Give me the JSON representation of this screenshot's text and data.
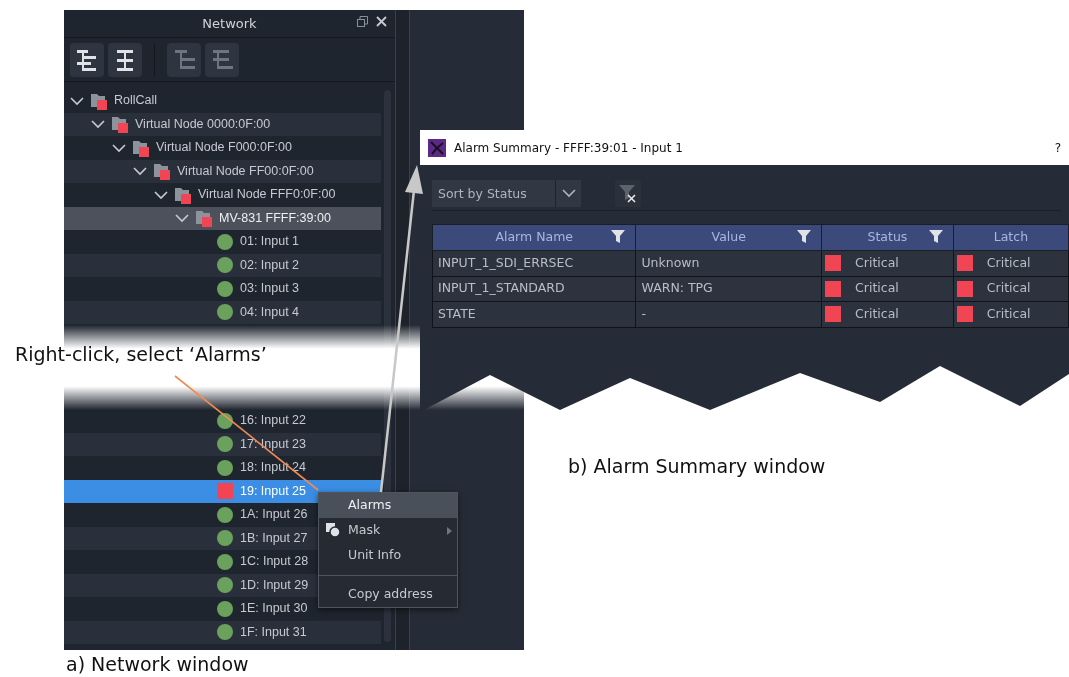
{
  "callout": {
    "text": "Right-click, select ‘Alarms’"
  },
  "network_window": {
    "title": "Network",
    "caption": "a) Network window",
    "toolbar": [
      {
        "kind": "expand",
        "disabled": false
      },
      {
        "kind": "collapse",
        "disabled": false
      },
      {
        "kind": "indent",
        "disabled": true
      },
      {
        "kind": "outdent",
        "disabled": true
      }
    ],
    "tree": [
      {
        "label": "RollCall",
        "kind": "folder",
        "color": "#f24553",
        "expanded": true,
        "selected": false,
        "highlighted": false,
        "children": [
          {
            "label": "Virtual Node 0000:0F:00",
            "kind": "folder",
            "color": "#f24553",
            "expanded": true,
            "selected": false,
            "highlighted": false,
            "children": [
              {
                "label": "Virtual Node F000:0F:00",
                "kind": "folder",
                "color": "#f24553",
                "expanded": true,
                "selected": false,
                "highlighted": false,
                "children": [
                  {
                    "label": "Virtual Node FF00:0F:00",
                    "kind": "folder",
                    "color": "#f24553",
                    "expanded": true,
                    "selected": false,
                    "highlighted": false,
                    "children": [
                      {
                        "label": "Virtual Node FFF0:0F:00",
                        "kind": "folder",
                        "color": "#f24553",
                        "expanded": true,
                        "selected": false,
                        "highlighted": false,
                        "children": [
                          {
                            "label": "MV-831 FFFF:39:00",
                            "kind": "folder",
                            "color": "#f24553",
                            "expanded": true,
                            "selected": false,
                            "highlighted": true,
                            "children": [
                              {
                                "label": "01: Input 1",
                                "kind": "input",
                                "color": "#6aa15c",
                                "selected": false,
                                "highlighted": false
                              },
                              {
                                "label": "02: Input 2",
                                "kind": "input",
                                "color": "#6aa15c",
                                "selected": false,
                                "highlighted": false
                              },
                              {
                                "label": "03: Input 3",
                                "kind": "input",
                                "color": "#6aa15c",
                                "selected": false,
                                "highlighted": false
                              },
                              {
                                "label": "04: Input 4",
                                "kind": "input",
                                "color": "#6aa15c",
                                "selected": false,
                                "highlighted": false
                              },
                              {
                                "label": "16: Input 22",
                                "kind": "input",
                                "color": "#6aa15c",
                                "selected": false,
                                "highlighted": false
                              },
                              {
                                "label": "17: Input 23",
                                "kind": "input",
                                "color": "#6aa15c",
                                "selected": false,
                                "highlighted": false
                              },
                              {
                                "label": "18: Input 24",
                                "kind": "input",
                                "color": "#6aa15c",
                                "selected": false,
                                "highlighted": false
                              },
                              {
                                "label": "19: Input 25",
                                "kind": "alarm",
                                "color": "#f24553",
                                "selected": true,
                                "highlighted": false
                              },
                              {
                                "label": "1A: Input 26",
                                "kind": "input",
                                "color": "#6aa15c",
                                "selected": false,
                                "highlighted": false
                              },
                              {
                                "label": "1B: Input 27",
                                "kind": "input",
                                "color": "#6aa15c",
                                "selected": false,
                                "highlighted": false
                              },
                              {
                                "label": "1C: Input 28",
                                "kind": "input",
                                "color": "#6aa15c",
                                "selected": false,
                                "highlighted": false
                              },
                              {
                                "label": "1D: Input 29",
                                "kind": "input",
                                "color": "#6aa15c",
                                "selected": false,
                                "highlighted": false
                              },
                              {
                                "label": "1E: Input 30",
                                "kind": "input",
                                "color": "#6aa15c",
                                "selected": false,
                                "highlighted": false
                              },
                              {
                                "label": "1F: Input 31",
                                "kind": "input",
                                "color": "#6aa15c",
                                "selected": false,
                                "highlighted": false
                              }
                            ]
                          }
                        ]
                      }
                    ]
                  }
                ]
              }
            ]
          }
        ]
      }
    ],
    "context_menu": [
      {
        "label": "Alarms",
        "kind": "item",
        "selected": true,
        "icon": false,
        "submenu": false
      },
      {
        "label": "Mask",
        "kind": "item",
        "selected": false,
        "icon": true,
        "submenu": true
      },
      {
        "label": "Unit Info",
        "kind": "item",
        "selected": false,
        "icon": false,
        "submenu": false
      },
      {
        "kind": "divider"
      },
      {
        "label": "Copy address",
        "kind": "item",
        "selected": false,
        "icon": false,
        "submenu": false
      }
    ]
  },
  "alarm_window": {
    "title": "Alarm Summary - FFFF:39:01 - Input 1",
    "help": "?",
    "caption": "b) Alarm Summary window",
    "sort": {
      "value": "Sort by Status"
    },
    "table": {
      "columns": [
        {
          "label": "Alarm Name",
          "filter": true
        },
        {
          "label": "Value",
          "filter": true
        },
        {
          "label": "Status",
          "filter": true
        },
        {
          "label": "Latch",
          "filter": false
        }
      ],
      "rows": [
        {
          "name": "INPUT_1_SDI_ERRSEC",
          "value": "Unknown",
          "status": {
            "text": "Critical",
            "color": "#f24553"
          },
          "latch": {
            "text": "Critical",
            "color": "#f24553"
          }
        },
        {
          "name": "INPUT_1_STANDARD",
          "value": "WARN: TPG",
          "status": {
            "text": "Critical",
            "color": "#f24553"
          },
          "latch": {
            "text": "Critical",
            "color": "#f24553"
          }
        },
        {
          "name": "STATE",
          "value": "-",
          "status": {
            "text": "Critical",
            "color": "#f24553"
          },
          "latch": {
            "text": "Critical",
            "color": "#f24553"
          }
        }
      ]
    }
  }
}
